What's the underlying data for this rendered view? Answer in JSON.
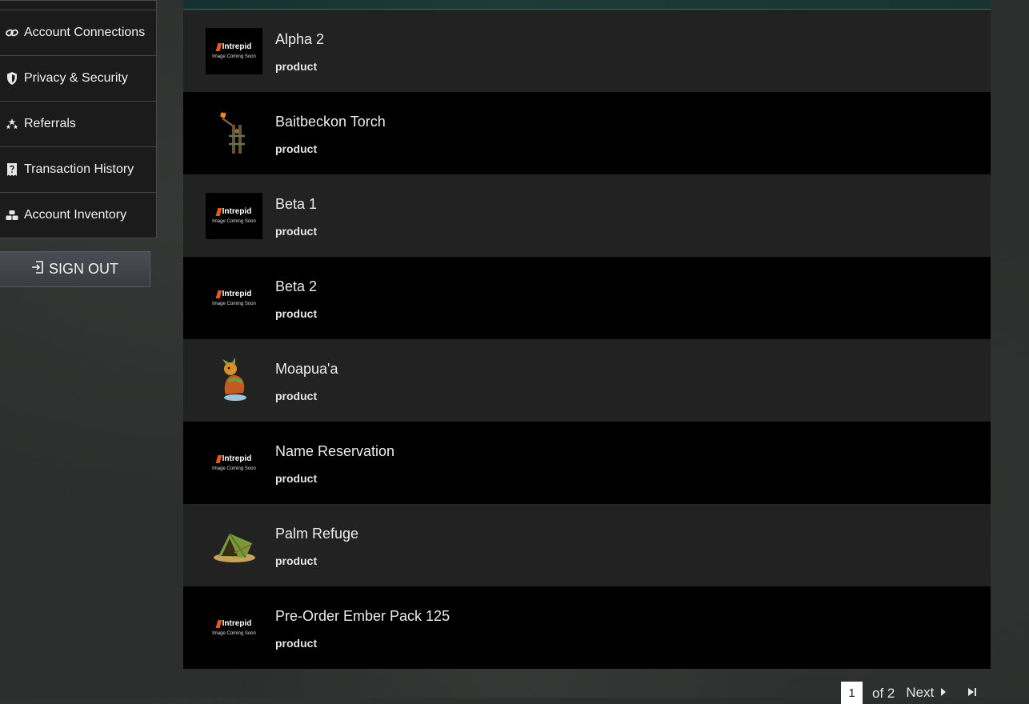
{
  "sidebar": {
    "items": [
      {
        "label": "Account Connections",
        "icon": "link-icon"
      },
      {
        "label": "Privacy & Security",
        "icon": "shield-icon"
      },
      {
        "label": "Referrals",
        "icon": "referrals-icon"
      },
      {
        "label": "Transaction History",
        "icon": "receipt-icon"
      },
      {
        "label": "Account Inventory",
        "icon": "inventory-icon"
      }
    ],
    "sign_out_label": "SIGN OUT"
  },
  "placeholder": {
    "brand": "Intrepid",
    "caption": "Image Coming Soon"
  },
  "items": [
    {
      "name": "Alpha 2",
      "type": "product"
    },
    {
      "name": "Baitbeckon Torch",
      "type": "product"
    },
    {
      "name": "Beta 1",
      "type": "product"
    },
    {
      "name": "Beta 2",
      "type": "product"
    },
    {
      "name": "Moapua'a",
      "type": "product"
    },
    {
      "name": "Name Reservation",
      "type": "product"
    },
    {
      "name": "Palm Refuge",
      "type": "product"
    },
    {
      "name": "Pre-Order Ember Pack 125",
      "type": "product"
    }
  ],
  "pagination": {
    "current_page": "1",
    "of_label": "of 2",
    "next_label": "Next"
  },
  "colors": {
    "row_odd": "#222222",
    "row_even": "#000000",
    "brand_orange": "#e45a1b"
  }
}
